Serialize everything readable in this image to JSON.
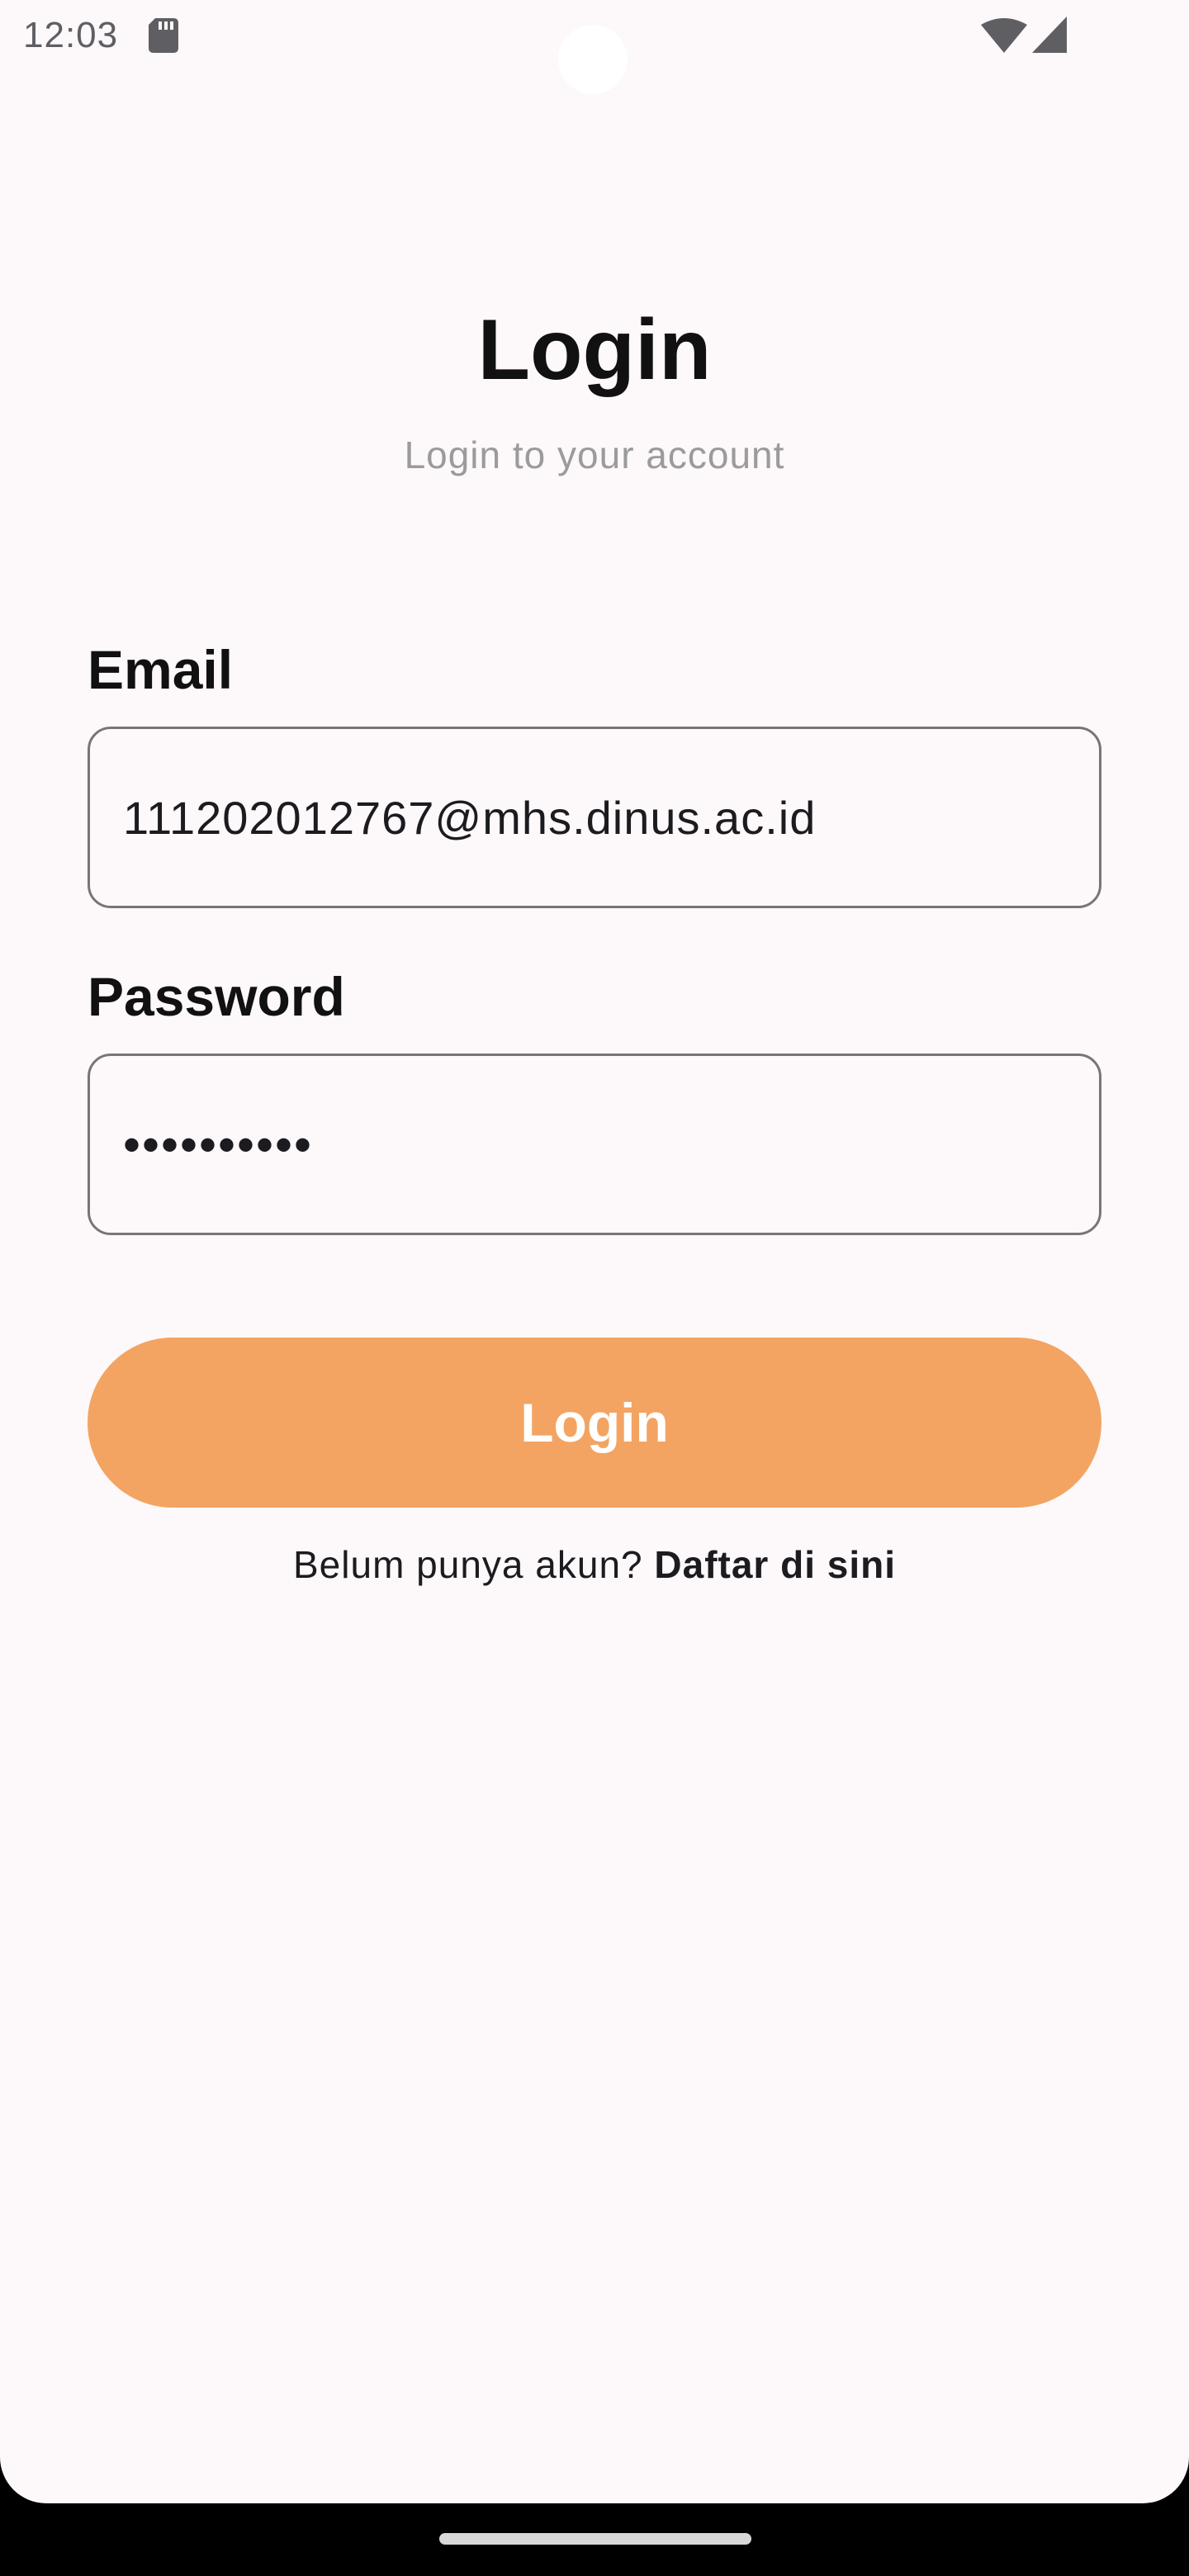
{
  "status_bar": {
    "time": "12:03",
    "icons": [
      "sd-card-icon",
      "wifi-icon",
      "signal-icon"
    ]
  },
  "header": {
    "title": "Login",
    "subtitle": "Login to your account"
  },
  "form": {
    "email": {
      "label": "Email",
      "value": "111202012767@mhs.dinus.ac.id"
    },
    "password": {
      "label": "Password",
      "value": "••••••••••"
    },
    "submit_label": "Login"
  },
  "footer": {
    "prompt": "Belum punya akun?",
    "register_link": "Daftar di sini"
  },
  "colors": {
    "accent": "#f3a462",
    "background": "#fdf8fa",
    "subtitle": "#9b9b9b",
    "input_border": "#7a7478"
  }
}
